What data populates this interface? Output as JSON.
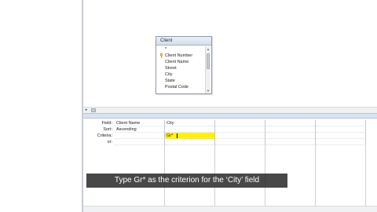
{
  "table": {
    "title": "Client",
    "fields": [
      {
        "label": "*",
        "key": false
      },
      {
        "label": "Client Number",
        "key": true
      },
      {
        "label": "Client Name",
        "key": false
      },
      {
        "label": "Street",
        "key": false
      },
      {
        "label": "City",
        "key": false
      },
      {
        "label": "State",
        "key": false
      },
      {
        "label": "Postal Code",
        "key": false
      }
    ]
  },
  "scroll": {
    "up_arrow": "▲",
    "down_arrow": "▼",
    "left_arrow": "◂"
  },
  "design_grid": {
    "row_labels": {
      "field": "Field:",
      "sort": "Sort:",
      "criteria": "Criteria:",
      "or": "or:"
    },
    "columns": [
      {
        "field": "Client Name",
        "sort": "Ascending",
        "criteria": "",
        "or": ""
      },
      {
        "field": "City",
        "sort": "",
        "criteria": "Gr*",
        "or": ""
      },
      {
        "field": "",
        "sort": "",
        "criteria": "",
        "or": ""
      },
      {
        "field": "",
        "sort": "",
        "criteria": "",
        "or": ""
      },
      {
        "field": "",
        "sort": "",
        "criteria": "",
        "or": ""
      }
    ]
  },
  "caption": "Type Gr* as the criterion for the ‘City’ field",
  "colors": {
    "criteria_highlight": "#fff200",
    "caption_bg": "#202020"
  }
}
